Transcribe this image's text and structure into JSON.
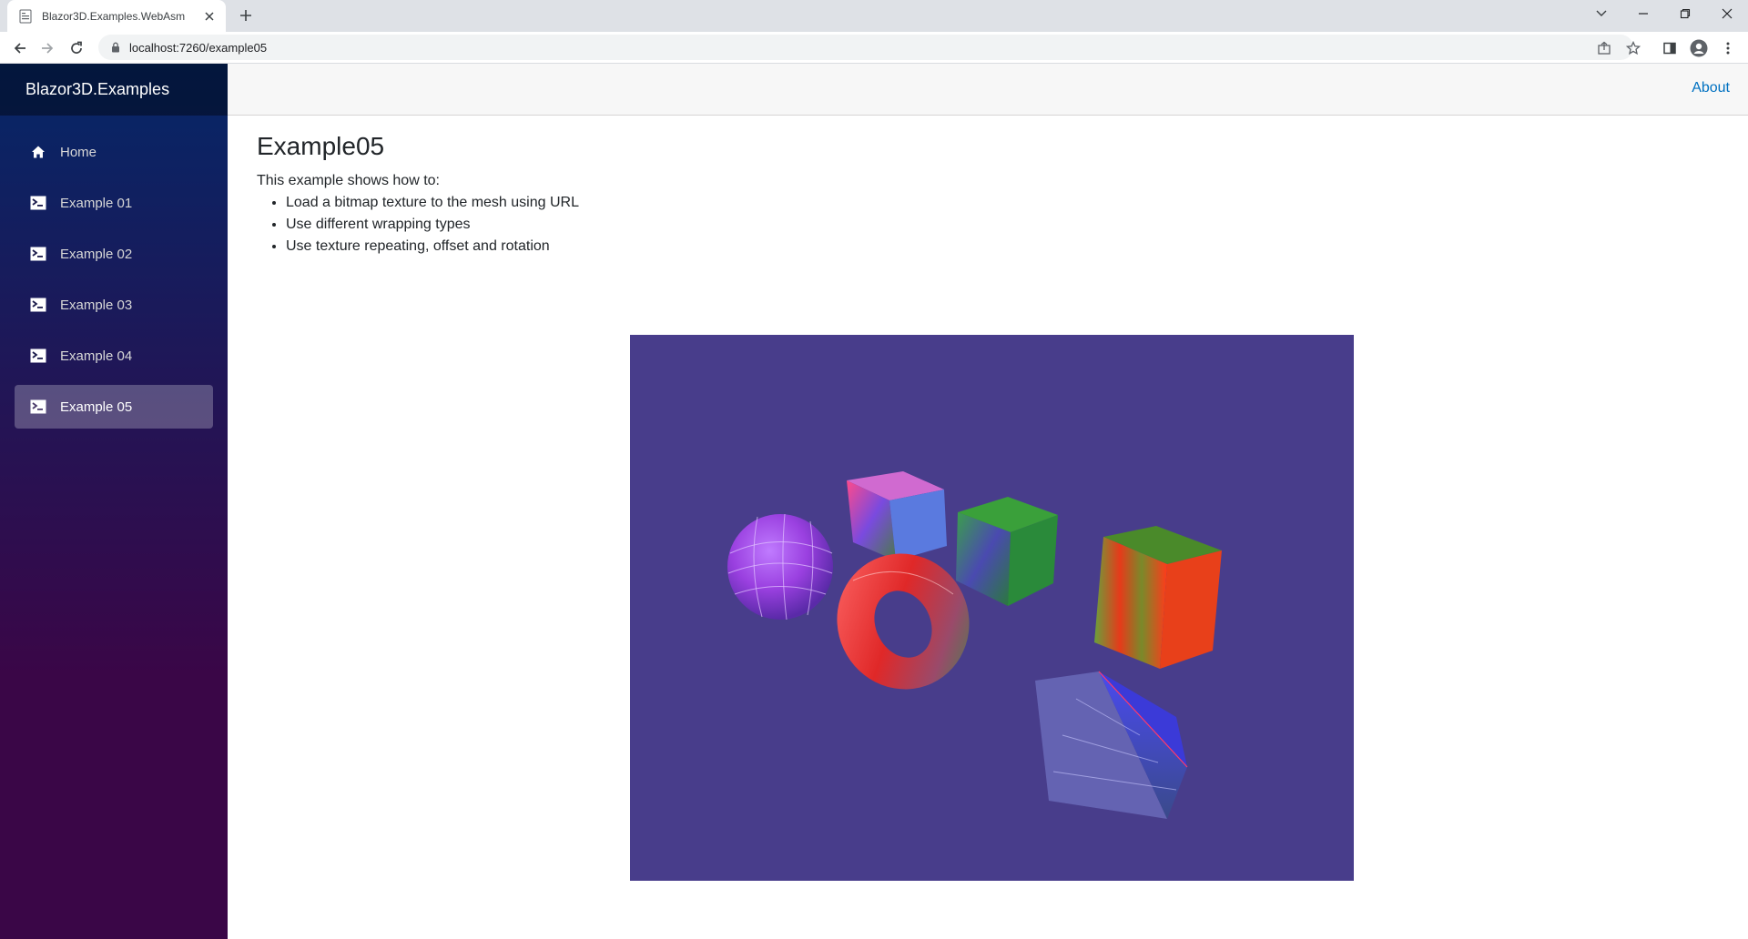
{
  "browser": {
    "tab_title": "Blazor3D.Examples.WebAsm",
    "url": "localhost:7260/example05"
  },
  "app": {
    "brand": "Blazor3D.Examples",
    "about_label": "About",
    "nav": [
      {
        "label": "Home",
        "icon": "home-icon",
        "active": false
      },
      {
        "label": "Example 01",
        "icon": "terminal-icon",
        "active": false
      },
      {
        "label": "Example 02",
        "icon": "terminal-icon",
        "active": false
      },
      {
        "label": "Example 03",
        "icon": "terminal-icon",
        "active": false
      },
      {
        "label": "Example 04",
        "icon": "terminal-icon",
        "active": false
      },
      {
        "label": "Example 05",
        "icon": "terminal-icon",
        "active": true
      }
    ]
  },
  "page": {
    "title": "Example05",
    "intro": "This example shows how to:",
    "bullets": [
      "Load a bitmap texture to the mesh using URL",
      "Use different wrapping types",
      "Use texture repeating, offset and rotation"
    ]
  },
  "scene": {
    "background_color": "#483d8b",
    "objects": [
      "sphere",
      "cube",
      "cube",
      "torus",
      "cube",
      "pyramid"
    ]
  },
  "colors": {
    "accent_link": "#0071c1",
    "sidebar_top": "#052767",
    "sidebar_bottom": "#3a0647"
  }
}
